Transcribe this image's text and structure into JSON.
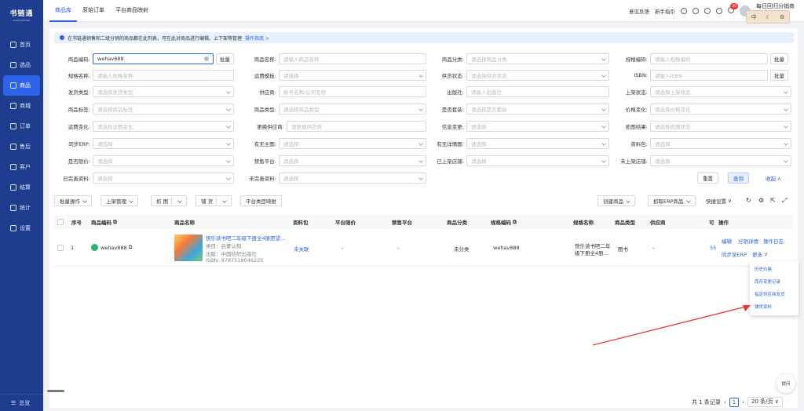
{
  "app": {
    "logo_text": "书链通",
    "logo_sub": "SHULIANTONG"
  },
  "sidebar": {
    "items": [
      {
        "label": "首页",
        "icon": "home-icon"
      },
      {
        "label": "选品",
        "icon": "select-icon"
      },
      {
        "label": "商品",
        "icon": "goods-icon",
        "active": true
      },
      {
        "label": "商城",
        "icon": "mall-icon"
      },
      {
        "label": "订单",
        "icon": "order-icon"
      },
      {
        "label": "售后",
        "icon": "aftersale-icon"
      },
      {
        "label": "客户",
        "icon": "customer-icon"
      },
      {
        "label": "结算",
        "icon": "settle-icon"
      },
      {
        "label": "统计",
        "icon": "stats-icon"
      },
      {
        "label": "设置",
        "icon": "settings-icon"
      }
    ],
    "bottom_label": "总览"
  },
  "topbar": {
    "tabs": [
      "商品库",
      "原始订单",
      "平台商品映射"
    ],
    "active_tab": 0,
    "feedback": "意见反馈",
    "guide": "新手指引",
    "badge_count": "20",
    "user_name": "每日回归分销商",
    "lang_cn": "中"
  },
  "notice": {
    "text": "在书链通销售和二级分销的商品都在此列表，可在此对商品进行编辑、上下架等管理",
    "link": "操作指南 >"
  },
  "filters": {
    "product_code": {
      "label": "商品编码:",
      "value": "wehav888",
      "bulk": "批量"
    },
    "product_name": {
      "label": "商品名称:",
      "placeholder": "请输入商品名称"
    },
    "category": {
      "label": "商品分类:",
      "placeholder": "请选择商品分类"
    },
    "spec_code": {
      "label": "规格编码:",
      "placeholder": "请输入规格编码",
      "bulk": "批量"
    },
    "spec_name": {
      "label": "规格名称:",
      "placeholder": "请输入规格名称"
    },
    "freight_tpl": {
      "label": "运费模板:",
      "placeholder": "请选择"
    },
    "supply_status": {
      "label": "供货状态:",
      "placeholder": "请选择供货状态"
    },
    "isbn": {
      "label": "ISBN:",
      "placeholder": "请输入ISBN",
      "bulk": "批量"
    },
    "ship_type": {
      "label": "发货类型:",
      "placeholder": "请选择发货类型"
    },
    "supplier": {
      "label": "供应商:",
      "placeholder": "账号名称/公司名称"
    },
    "publisher": {
      "label": "出版社:",
      "placeholder": "请输入出版社"
    },
    "listing_status": {
      "label": "上架状态:",
      "placeholder": "请选择上架状态"
    },
    "product_tag": {
      "label": "商品标签:",
      "placeholder": "请选择商品标签"
    },
    "product_type": {
      "label": "商品类型:",
      "placeholder": "请选择商品类型"
    },
    "is_bundle": {
      "label": "是否套装:",
      "placeholder": "请选择是否套装"
    },
    "price_change": {
      "label": "价格变化:",
      "placeholder": "请选择价格变化"
    },
    "freight_change": {
      "label": "运费变化:",
      "placeholder": "请选择运费变化"
    },
    "change_supplier": {
      "label": "更换供应商:",
      "placeholder": "请更换供应商"
    },
    "info_change": {
      "label": "信息变更:",
      "placeholder": "请选择"
    },
    "crawl_result": {
      "label": "抓图结果:",
      "placeholder": "请选择抓图状态"
    },
    "sync_erp": {
      "label": "同步ERP:",
      "placeholder": "请选择"
    },
    "has_main_img": {
      "label": "有无主图:",
      "placeholder": "请选择"
    },
    "has_detail_img": {
      "label": "有无详情图:",
      "placeholder": "请选择"
    },
    "material_pack": {
      "label": "资料包:",
      "placeholder": "请选择"
    },
    "price_limit": {
      "label": "是否限价:",
      "placeholder": "请选择"
    },
    "banned_platform": {
      "label": "禁售平台:",
      "placeholder": "请选择"
    },
    "listed_shop": {
      "label": "已上架店铺:",
      "placeholder": "请选择"
    },
    "unlisted_shop": {
      "label": "未上架店铺:",
      "placeholder": "请选择"
    },
    "complete_info": {
      "label": "已完善资料:",
      "placeholder": "请选择"
    },
    "incomplete_info": {
      "label": "未完善资料:",
      "placeholder": "请选择"
    },
    "reset": "重置",
    "query": "查询",
    "collapse": "收起"
  },
  "toolbar": {
    "batch_ops": "批量操作",
    "listing_mgmt": "上架管理",
    "crawl_img": "抓 图",
    "fill_stock": "铺 货",
    "platform_map": "平台类目映射",
    "create_product": "创建商品",
    "fetch_erp": "抓取ERP商品",
    "quick_settings": "快捷设置"
  },
  "table": {
    "headers": [
      "序号",
      "商品编码",
      "商品名称",
      "资料包",
      "平台限价",
      "禁售平台",
      "商品分类",
      "规格编码",
      "规格名称",
      "商品类型",
      "供应商",
      "可",
      "操作"
    ],
    "rows": [
      {
        "index": "1",
        "code": "wehav888",
        "title": "快乐读书吧二年级下册全4册愿望...",
        "category_line": "类目：启蒙认知",
        "publisher_line": "出版：中国纺织出版社",
        "isbn_line": "ISBN: 9787518046225",
        "material": "未关联",
        "price_limit": "-",
        "banned": "-",
        "product_category": "未分类",
        "spec_code": "wehav888",
        "spec_name_1": "快乐读书吧二年",
        "spec_name_2": "级下册全4册...",
        "product_type": "图书",
        "supplier": "-",
        "stock": "55",
        "actions": [
          "编辑",
          "分销详情",
          "操作日志",
          "同步至ERP",
          "更多"
        ]
      }
    ]
  },
  "more_menu": {
    "items": [
      "历史价格",
      "库存变更记录",
      "指定供应商发货",
      "铺货资料"
    ]
  },
  "pager": {
    "total": "共 1 条记录",
    "page": "1",
    "page_size": "20 条/页"
  },
  "chat": {
    "label": "提问"
  }
}
